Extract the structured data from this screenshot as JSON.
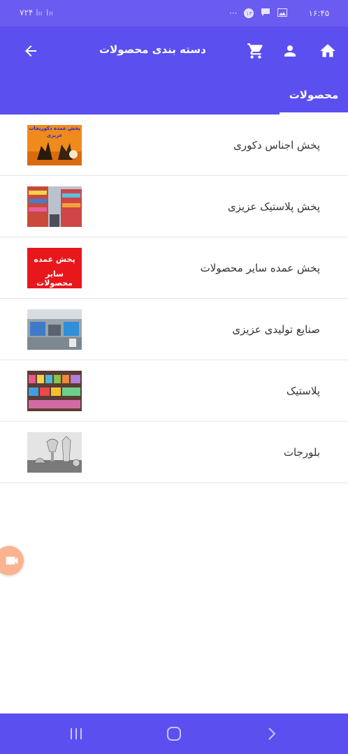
{
  "status_bar": {
    "time": "۱۶:۴۵",
    "left_indicators": "۷۲۴ ⁞ₗₗ ⁞ₗₗ",
    "notification_count": "۱۳",
    "dots": "···"
  },
  "app_bar": {
    "title": "دسته بندی محصولات",
    "icons": [
      "arrow-back-icon",
      "cart-icon",
      "person-icon",
      "home-icon"
    ]
  },
  "tabs": [
    {
      "label": "محصولات",
      "active": true
    }
  ],
  "categories": [
    {
      "label": "پخش اجناس دکوری",
      "thumb_text": [
        "پخش عمده دکوریجات",
        "عزیزی"
      ]
    },
    {
      "label": "پخش پلاستیک عزیزی"
    },
    {
      "label": "پخش عمده سایر محصولات",
      "thumb_text": [
        "پخش عمده",
        "سایر محصولات"
      ]
    },
    {
      "label": "صنایع تولیدی عزیزی"
    },
    {
      "label": "پلاستیک"
    },
    {
      "label": "بلورجات"
    }
  ],
  "colors": {
    "primary": "#5b4fef",
    "status_bar": "#6a5cf0",
    "fab": "#fbb48f"
  }
}
